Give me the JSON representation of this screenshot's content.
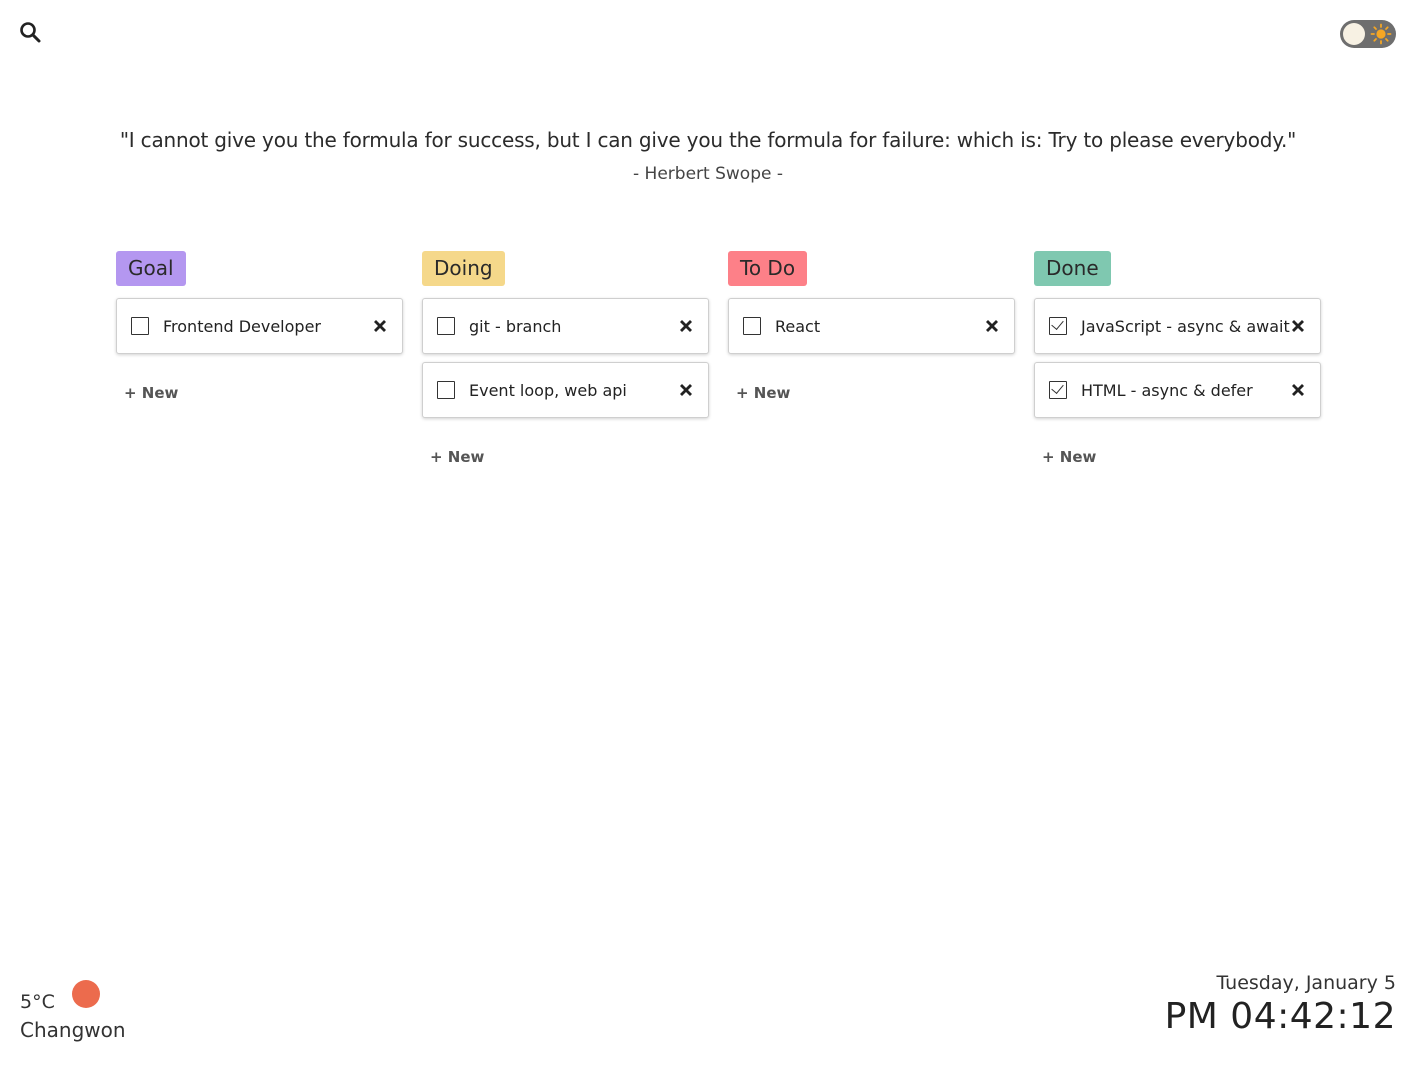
{
  "header": {
    "search_icon": "search-icon",
    "theme_toggle_icon": "sun-icon"
  },
  "quote": {
    "text": "\"I cannot give you the formula for success, but I can give you the formula for failure: which is: Try to please everybody.\"",
    "author": "- Herbert Swope -"
  },
  "board": {
    "columns": [
      {
        "title": "Goal",
        "color": "#b497f0",
        "cards": [
          {
            "text": "Frontend Developer",
            "checked": false
          }
        ],
        "new_label": "+ New"
      },
      {
        "title": "Doing",
        "color": "#f5d88a",
        "cards": [
          {
            "text": "git - branch",
            "checked": false
          },
          {
            "text": "Event loop, web api",
            "checked": false
          }
        ],
        "new_label": "+ New"
      },
      {
        "title": "To Do",
        "color": "#fd8088",
        "cards": [
          {
            "text": "React",
            "checked": false
          }
        ],
        "new_label": "+ New"
      },
      {
        "title": "Done",
        "color": "#7fc8b0",
        "cards": [
          {
            "text": "JavaScript - async & await",
            "checked": true
          },
          {
            "text": "HTML - async & defer",
            "checked": true
          }
        ],
        "new_label": "+ New"
      }
    ]
  },
  "weather": {
    "temperature": "5°C",
    "icon_color": "#ec6b4d",
    "city": "Changwon"
  },
  "clock": {
    "date": "Tuesday, January 5",
    "time": "PM 04:42:12"
  }
}
